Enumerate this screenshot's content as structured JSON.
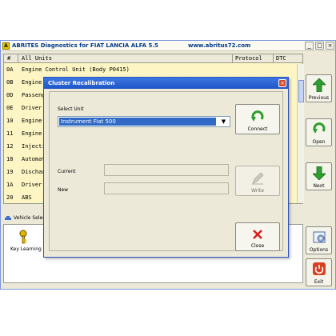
{
  "window": {
    "app_icon_text": "A",
    "title": "ABRITES Diagnostics for FIAT LANCIA ALFA 5.5",
    "url": "www.abritus72.com",
    "controls": {
      "minimize": "_",
      "maximize": "□",
      "close": "×"
    }
  },
  "list": {
    "columns": {
      "number": "#",
      "units": "All Units",
      "protocol": "Protocol",
      "dtc": "DTC"
    },
    "rows": [
      {
        "id": "0A",
        "name": "Engine Control Unit (Body P0415)"
      },
      {
        "id": "0B",
        "name": "Engine S"
      },
      {
        "id": "0D",
        "name": "Passenge"
      },
      {
        "id": "0E",
        "name": "Driver's"
      },
      {
        "id": "10",
        "name": "Engine C"
      },
      {
        "id": "11",
        "name": "Engine C"
      },
      {
        "id": "12",
        "name": "Injectio"
      },
      {
        "id": "18",
        "name": "Automati"
      },
      {
        "id": "19",
        "name": "Discharg"
      },
      {
        "id": "1A",
        "name": "Driver's"
      },
      {
        "id": "20",
        "name": "ABS"
      }
    ],
    "row_colors": {
      "text": "#000000",
      "background": "#fdf6c4"
    }
  },
  "vehicle_panel": {
    "tab_label": "Vehicle Selection",
    "key_learning_label": "Key Learning",
    "fragment_label": "C"
  },
  "side_buttons": {
    "previous": "Previous",
    "open": "Open",
    "next": "Next",
    "options": "Options",
    "exit": "Exit"
  },
  "dialog": {
    "title": "Cluster Recalibration",
    "close_glyph": "×",
    "select_unit_label": "Select Unit",
    "selected_unit": "Instrument Fiat 500",
    "dropdown_arrow": "▼",
    "current_label": "Current",
    "new_label": "New",
    "current_value": "",
    "new_value": "",
    "connect_label": "Connect",
    "write_label": "Write",
    "close_label": "Close"
  },
  "colors": {
    "accent": "#316ac5",
    "title_blue": "#1d55c8",
    "arrow_green": "#2e9e2e",
    "close_red": "#d81e1e",
    "exit_red": "#d84020"
  }
}
